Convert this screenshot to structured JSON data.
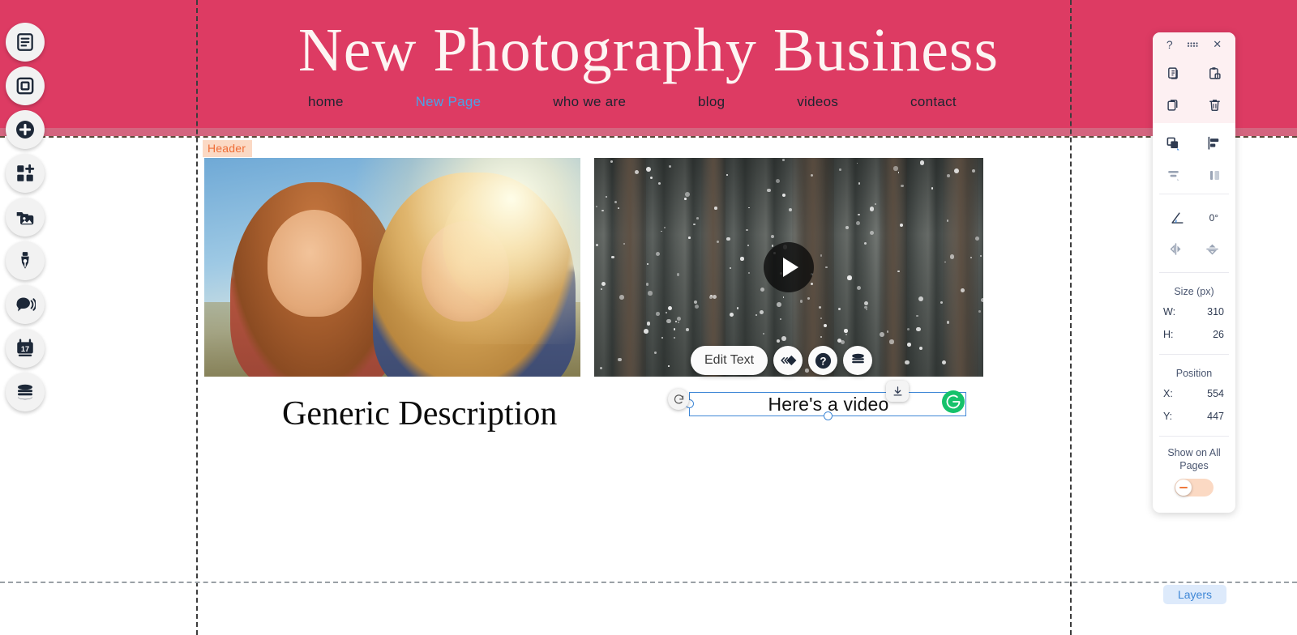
{
  "site": {
    "title": "New Photography Business",
    "header_bg": "#dd3b63",
    "nav": [
      {
        "label": "home",
        "active": false
      },
      {
        "label": "New Page",
        "active": true
      },
      {
        "label": "who we are",
        "active": false
      },
      {
        "label": "blog",
        "active": false
      },
      {
        "label": "videos",
        "active": false
      },
      {
        "label": "contact",
        "active": false
      }
    ],
    "section_label": "Header",
    "description": "Generic Description",
    "selected_text": "Here's a video"
  },
  "rail": {
    "items": [
      {
        "icon": "page-icon",
        "name": "pages"
      },
      {
        "icon": "square-icon",
        "name": "sections"
      },
      {
        "icon": "plus-circle-icon",
        "name": "add"
      },
      {
        "icon": "apps-grid-icon",
        "name": "apps"
      },
      {
        "icon": "media-library-icon",
        "name": "media"
      },
      {
        "icon": "pen-nib-icon",
        "name": "blog"
      },
      {
        "icon": "chat-bubble-icon",
        "name": "chat"
      },
      {
        "icon": "calendar-icon",
        "name": "bookings"
      },
      {
        "icon": "database-icon",
        "name": "cms"
      }
    ]
  },
  "toolbar": {
    "edit_text_label": "Edit Text",
    "buttons": [
      {
        "icon": "animation-icon",
        "name": "animation"
      },
      {
        "icon": "help-icon",
        "name": "help"
      },
      {
        "icon": "database-icon",
        "name": "connect-data"
      }
    ]
  },
  "handles": {
    "rotate_icon": "rotate-icon",
    "anchor_icon": "pin-to-bottom-icon",
    "grammarly_icon": "grammarly-icon"
  },
  "panel": {
    "header": {
      "help": "?",
      "drag": "::::",
      "close": "✕"
    },
    "clipboard": [
      {
        "icon": "copy-icon",
        "name": "copy"
      },
      {
        "icon": "paste-icon",
        "name": "paste"
      },
      {
        "icon": "duplicate-icon",
        "name": "duplicate"
      },
      {
        "icon": "trash-icon",
        "name": "delete"
      }
    ],
    "arrange": [
      {
        "icon": "arrange-layers-icon",
        "name": "arrange"
      },
      {
        "icon": "align-icon",
        "name": "align"
      },
      {
        "icon": "distribute-vertical-icon",
        "name": "distribute-vertical"
      },
      {
        "icon": "distribute-horizontal-icon",
        "name": "distribute-horizontal"
      }
    ],
    "rotation": {
      "icon": "angle-icon",
      "value": "0°"
    },
    "flip": [
      {
        "icon": "flip-horizontal-icon",
        "name": "flip-horizontal"
      },
      {
        "icon": "flip-vertical-icon",
        "name": "flip-vertical"
      }
    ],
    "size": {
      "title": "Size (px)",
      "w_label": "W:",
      "w_value": "310",
      "h_label": "H:",
      "h_value": "26"
    },
    "position": {
      "title": "Position",
      "x_label": "X:",
      "x_value": "554",
      "y_label": "Y:",
      "y_value": "447"
    },
    "show_all_pages": {
      "label": "Show on All Pages",
      "enabled": false
    },
    "layers_label": "Layers"
  },
  "colors": {
    "brand_pink": "#dd3b63",
    "accent_blue": "#3f87d6",
    "label_orange": "#ef6d36",
    "label_bg": "#fbd9c4",
    "grammarly_green": "#15c26b",
    "toggle_track": "#fbd9c3"
  }
}
